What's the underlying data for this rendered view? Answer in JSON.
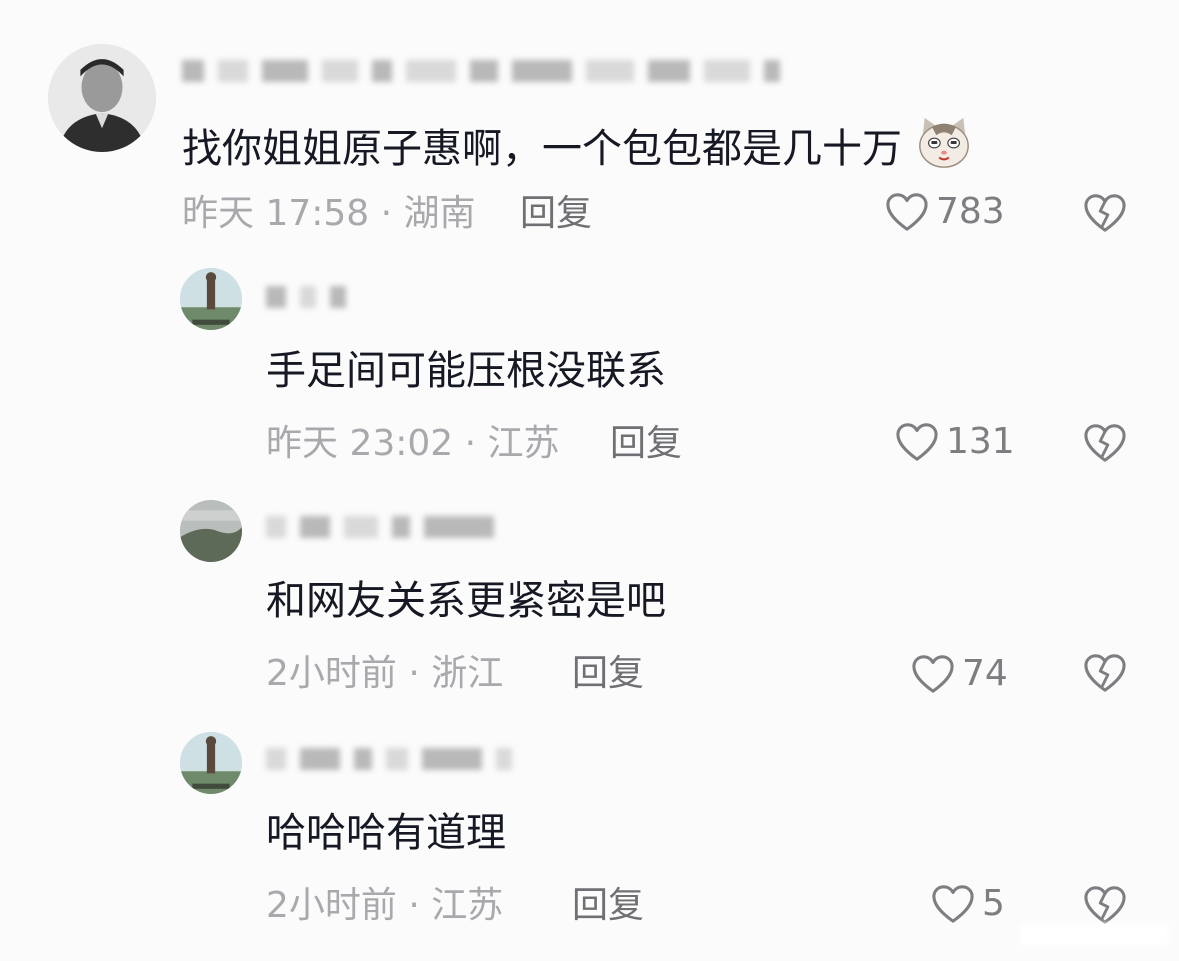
{
  "colors": {
    "text": "#161823",
    "meta": "#a8a9ad",
    "reply": "#6f7073",
    "icon": "#7d7e82",
    "background": "#fbfbfb"
  },
  "comments": [
    {
      "text": "找你姐姐原子惠啊，一个包包都是几十万",
      "emoji": "cat-face-emoji",
      "time_location": "昨天 17:58 · 湖南",
      "reply_label": "回复",
      "likes": "783"
    },
    {
      "text": "手足间可能压根没联系",
      "time_location": "昨天 23:02 · 江苏",
      "reply_label": "回复",
      "likes": "131"
    },
    {
      "text": "和网友关系更紧密是吧",
      "time_location": "2小时前 · 浙江",
      "reply_label": "回复",
      "likes": "74"
    },
    {
      "text": "哈哈哈有道理",
      "time_location": "2小时前 · 江苏",
      "reply_label": "回复",
      "likes": "5"
    }
  ]
}
